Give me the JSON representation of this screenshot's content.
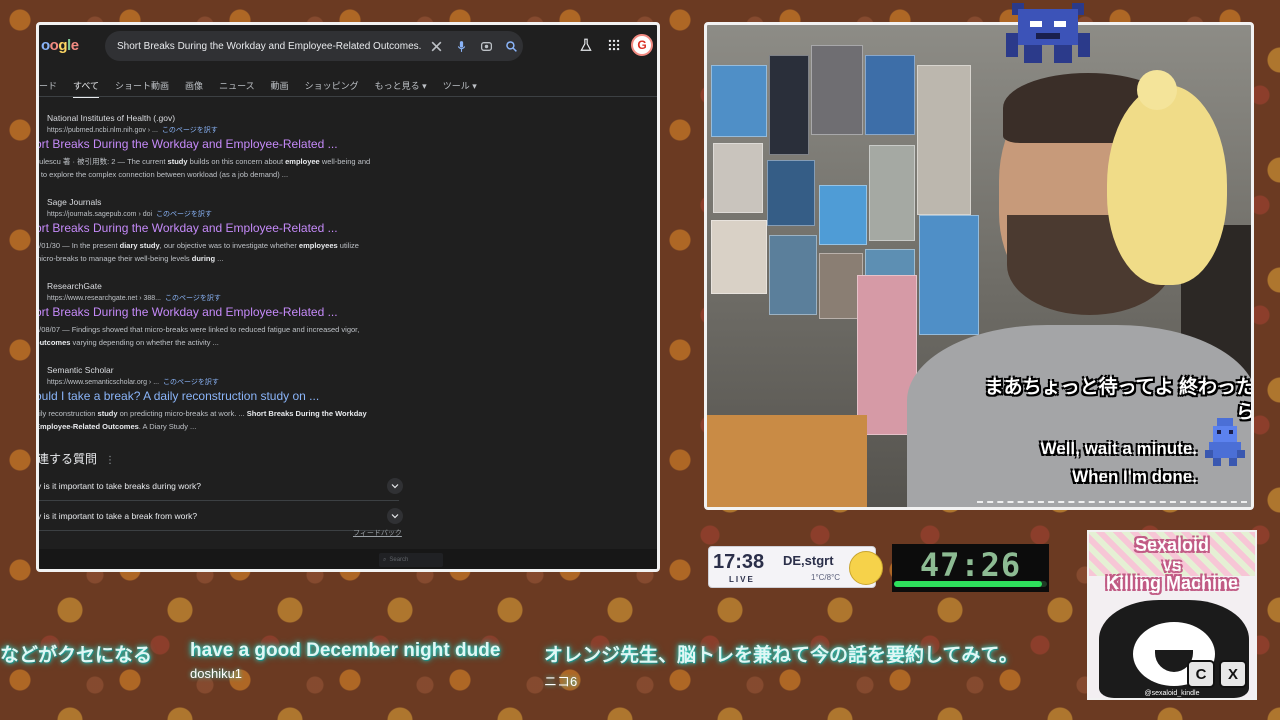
{
  "browser": {
    "logo": "oogle",
    "search_query": "Short Breaks During the Workday and Employee-Related Outcomes. A Dia",
    "avatar_letter": "G",
    "tabs": [
      "ード",
      "すべて",
      "ショート動画",
      "画像",
      "ニュース",
      "動画",
      "ショッピング",
      "もっと見る ▾",
      "ツール ▾"
    ],
    "results": [
      {
        "site": "National Institutes of Health (.gov)",
        "url": "https://pubmed.ncbi.nlm.nih.gov › ...",
        "translate": "このページを訳す",
        "title": "ort Breaks During the Workday and Employee-Related ...",
        "snippet_line1": "oulescu 著 · 被引用数: 2 — The current study builds on this concern about employee well-being and",
        "snippet_line2": "s to explore the complex connection between workload (as a job demand) ..."
      },
      {
        "site": "Sage Journals",
        "url": "https://journals.sagepub.com › doi",
        "translate": "このページを訳す",
        "title": "ort Breaks During the Workday and Employee-Related ...",
        "snippet_line1": "5/01/30 — In the present diary study, our objective was to investigate whether employees utilize",
        "snippet_line2": "micro-breaks to manage their well-being levels during ..."
      },
      {
        "site": "ResearchGate",
        "url": "https://www.researchgate.net › 388...",
        "translate": "このページを訳す",
        "title": "ort Breaks During the Workday and Employee-Related ...",
        "snippet_line1": "5/08/07 — Findings showed that micro-breaks were linked to reduced fatigue and increased vigor,",
        "snippet_line2": "outcomes varying depending on whether the activity ..."
      },
      {
        "site": "Semantic Scholar",
        "url": "https://www.semanticscholar.org › ...",
        "translate": "このページを訳す",
        "title": "ould I take a break? A daily reconstruction study on ...",
        "snippet_line1": "aily reconstruction study on predicting micro-breaks at work. ... Short Breaks During the Workday",
        "snippet_line2": "Employee-Related Outcomes. A Diary Study ..."
      }
    ],
    "paa_title": "連する質問",
    "paa_items": [
      "y is it important to take breaks during work?",
      "y is it important to take a break from work?"
    ],
    "feedback": "フィードバック",
    "mini_search": "Search"
  },
  "camera": {
    "subtitle_jp": "まあちょっと待ってよ 終わったら",
    "subtitle_en_line1": "Well, wait a minute.",
    "subtitle_en_line2": "When I'm done."
  },
  "clock": {
    "time": "17:38",
    "live": "LIVE",
    "location": "DE,stgrt",
    "temp": "1°C/8°C"
  },
  "timer": {
    "value": "47:26",
    "progress": 0.97
  },
  "poster": {
    "title1": "Sexaloid",
    "vs": "VS",
    "title2": "Killing Machine",
    "logo1": "C",
    "logo2": "X",
    "handle": "@sexaloid_kindle"
  },
  "chat": [
    {
      "text": "などがクセになる",
      "user": ""
    },
    {
      "text": "have a good December night dude",
      "user": "doshiku1"
    },
    {
      "text": "オレンジ先生、脳トレを兼ねて今の話を要約してみて。",
      "user": "ニコ6"
    }
  ],
  "colors": {
    "visited_link": "#c58af9",
    "link": "#8ab4f8",
    "chat_glow": "#3fd6c8",
    "timer_green": "#2ee05c"
  }
}
